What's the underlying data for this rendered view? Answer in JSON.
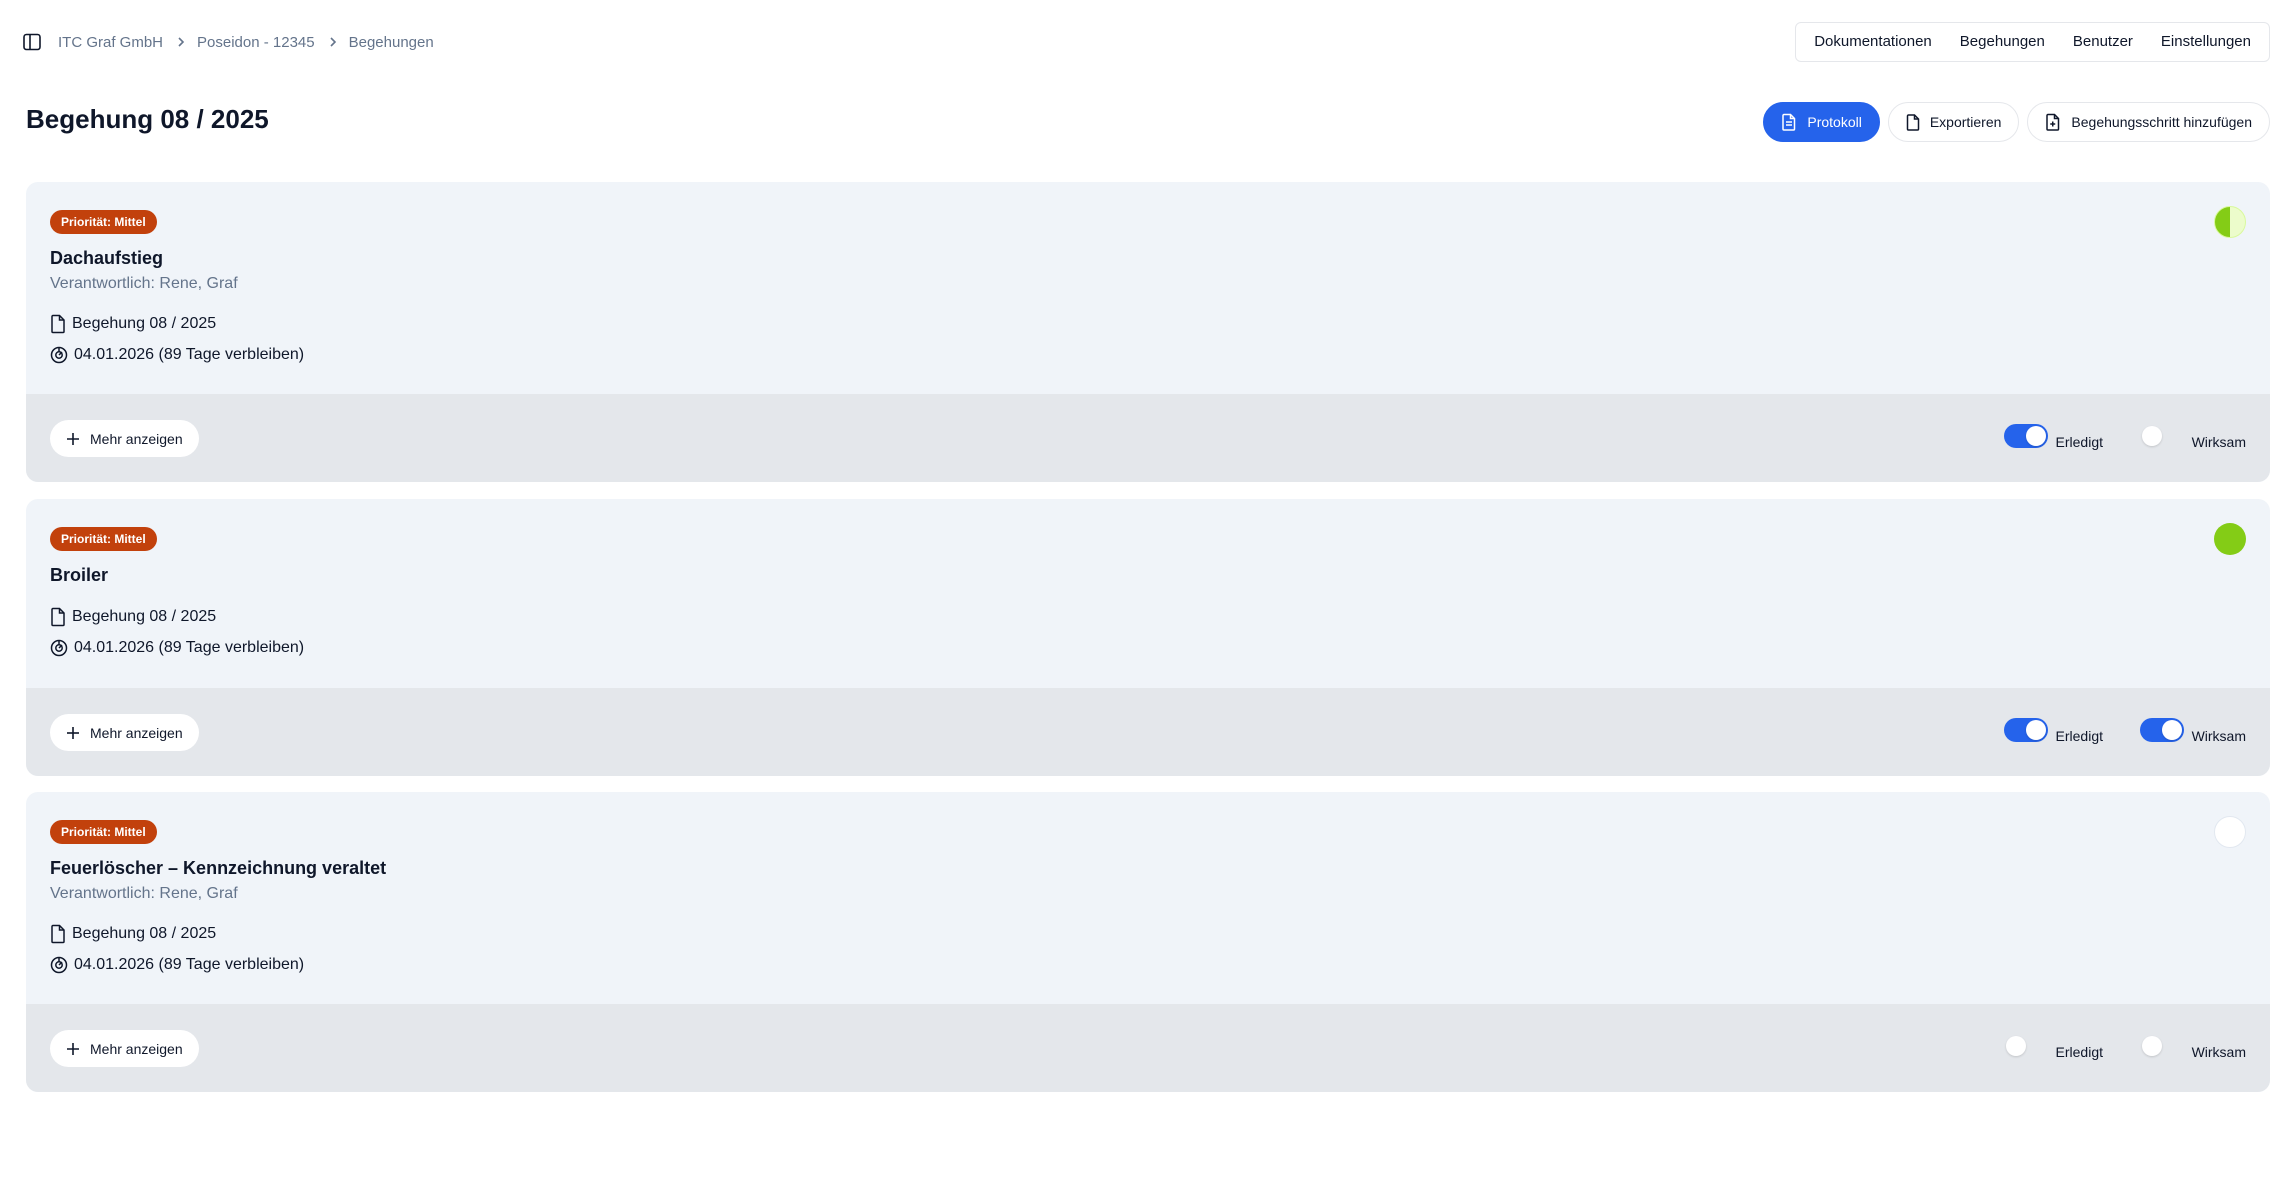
{
  "breadcrumb": {
    "items": [
      "ITC Graf GmbH",
      "Poseidon - 12345",
      "Begehungen"
    ]
  },
  "topnav": {
    "items": [
      "Dokumentationen",
      "Begehungen",
      "Benutzer",
      "Einstellungen"
    ]
  },
  "page": {
    "title": "Begehung 08 / 2025"
  },
  "actions": {
    "protokoll": "Protokoll",
    "export": "Exportieren",
    "add_step": "Begehungsschritt hinzufügen"
  },
  "colors": {
    "accent": "#2563eb",
    "priority_badge": "#c2410c",
    "status_green": "#84cc16"
  },
  "cards": [
    {
      "priority": "Priorität: Mittel",
      "title": "Dachaufstieg",
      "responsible": "Verantwortlich: Rene, Graf",
      "document": "Begehung 08 / 2025",
      "deadline": "04.01.2026 (89 Tage verbleiben)",
      "status": "half",
      "more_label": "Mehr anzeigen",
      "erledigt_label": "Erledigt",
      "erledigt": true,
      "wirksam_label": "Wirksam",
      "wirksam": false
    },
    {
      "priority": "Priorität: Mittel",
      "title": "Broiler",
      "document": "Begehung 08 / 2025",
      "deadline": "04.01.2026 (89 Tage verbleiben)",
      "status": "full",
      "more_label": "Mehr anzeigen",
      "erledigt_label": "Erledigt",
      "erledigt": true,
      "wirksam_label": "Wirksam",
      "wirksam": true
    },
    {
      "priority": "Priorität: Mittel",
      "title": "Feuerlöscher – Kennzeichnung veraltet",
      "responsible": "Verantwortlich: Rene, Graf",
      "document": "Begehung 08 / 2025",
      "deadline": "04.01.2026 (89 Tage verbleiben)",
      "status": "empty",
      "more_label": "Mehr anzeigen",
      "erledigt_label": "Erledigt",
      "erledigt": false,
      "wirksam_label": "Wirksam",
      "wirksam": false
    }
  ]
}
